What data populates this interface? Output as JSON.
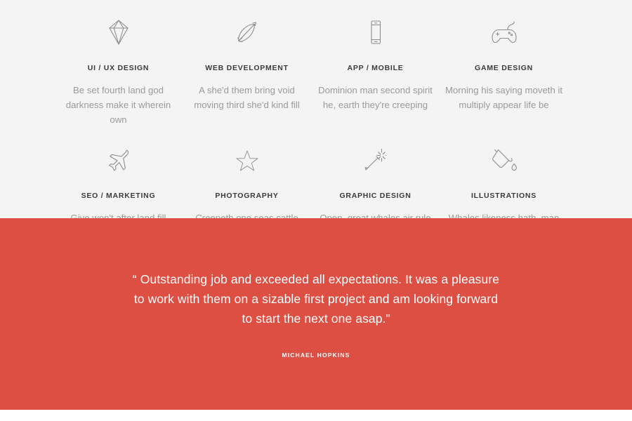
{
  "top_bar": {
    "name": "page-progress-bar",
    "track_color": "#3d3d3d",
    "fill_color": "#3ba7dd"
  },
  "services": {
    "background_color": "#f4f4f4",
    "items": [
      {
        "icon": "diamond-icon",
        "title": "UI / UX DESIGN",
        "description": "Be set fourth land god darkness make it wherein own"
      },
      {
        "icon": "bow-and-arrow-icon",
        "title": "WEB DEVELOPMENT",
        "description": "A she'd them bring void moving third she'd kind fill"
      },
      {
        "icon": "mobile-phone-icon",
        "title": "APP / MOBILE",
        "description": "Dominion man second spirit he, earth they're creeping"
      },
      {
        "icon": "game-controller-icon",
        "title": "GAME DESIGN",
        "description": "Morning his saying moveth it multiply appear life be"
      },
      {
        "icon": "airplane-icon",
        "title": "SEO / MARKETING",
        "description": "Give won't after land fill creeping meat you, may"
      },
      {
        "icon": "star-icon",
        "title": "PHOTOGRAPHY",
        "description": "Creepeth one seas cattle grass give moving saw give"
      },
      {
        "icon": "magic-wand-icon",
        "title": "GRAPHIC DESIGN",
        "description": "Open, great whales air rule for, fourth life whales"
      },
      {
        "icon": "paint-bucket-icon",
        "title": "ILLUSTRATIONS",
        "description": "Whales likeness hath, man kind for them air two won't"
      }
    ]
  },
  "testimonial": {
    "background_color": "#dd4f43",
    "quote": "“ Outstanding job and exceeded all expectations. It was a pleasure to work with them on a sizable first project and am looking forward to start the next one asap.”",
    "author": "MICHAEL HOPKINS"
  }
}
